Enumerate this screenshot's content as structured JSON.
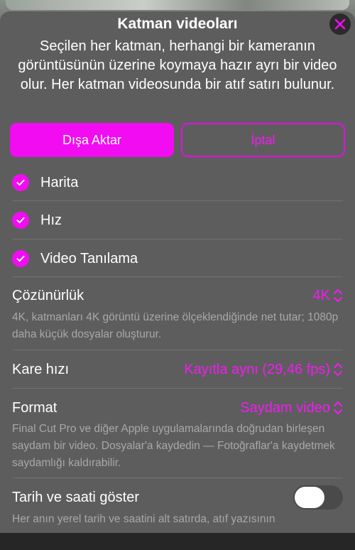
{
  "header": {
    "title": "Katman videoları",
    "description": "Seçilen her katman, herhangi bir kameranın görüntüsünün üzerine koymaya hazır ayrı bir video olur. Her katman videosunda bir atıf satırı bulunur."
  },
  "actions": {
    "export_label": "Dışa Aktar",
    "cancel_label": "İptal"
  },
  "layers": [
    {
      "label": "Harita",
      "checked": true
    },
    {
      "label": "Hız",
      "checked": true
    },
    {
      "label": "Video Tanılama",
      "checked": true
    }
  ],
  "resolution": {
    "label": "Çözünürlük",
    "value": "4K",
    "description": "4K, katmanları 4K görüntü üzerine ölçeklendiğinde net tutar; 1080p daha küçük dosyalar oluşturur."
  },
  "frame_rate": {
    "label": "Kare hızı",
    "value": "Kayıtla aynı (29,46 fps)"
  },
  "format": {
    "label": "Format",
    "value": "Saydam video",
    "description": "Final Cut Pro ve diğer Apple uygulamalarında doğrudan birleşen saydam bir video. Dosyalar'a kaydedin — Fotoğraflar'a kaydetmek saydamlığı kaldırabilir."
  },
  "show_datetime": {
    "label": "Tarih ve saati göster",
    "enabled": false,
    "description": "Her anın yerel tarih ve saatini alt satırda, atıf yazısının"
  },
  "colors": {
    "accent": "#f20cf2",
    "sheet": "#5d5d5d",
    "secondary_text": "#a8a8a8"
  }
}
